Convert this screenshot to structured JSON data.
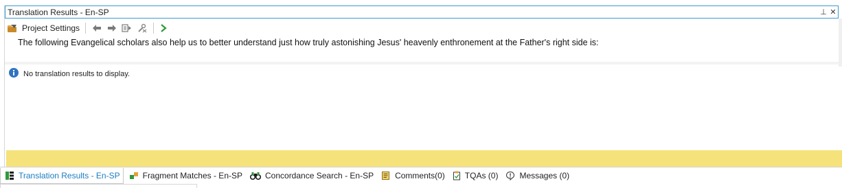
{
  "window": {
    "title": "Translation Results - En-SP",
    "pin_glyph": "⊥",
    "close_glyph": "✕"
  },
  "toolbar": {
    "project_settings_label": "Project Settings",
    "icons": [
      "project-settings-icon",
      "arrow-left-icon",
      "arrow-right-icon",
      "apply-icon",
      "tools-icon",
      "play-icon"
    ]
  },
  "source_segment": "The following Evangelical scholars also help us to better understand just how truly astonishing Jesus' heavenly enthronement at the Father's right side is:",
  "results": {
    "empty_message": "No translation results to display."
  },
  "tabs": [
    {
      "label": "Translation Results - En-SP",
      "icon": "translation-results-icon",
      "active": true
    },
    {
      "label": "Fragment Matches - En-SP",
      "icon": "fragment-matches-icon",
      "active": false
    },
    {
      "label": "Concordance Search - En-SP",
      "icon": "binoculars-icon",
      "active": false
    },
    {
      "label": "Comments(0)",
      "icon": "comments-icon",
      "active": false
    },
    {
      "label": "TQAs (0)",
      "icon": "tqa-icon",
      "active": false
    },
    {
      "label": "Messages (0)",
      "icon": "messages-icon",
      "active": false
    }
  ],
  "colors": {
    "accent": "#3a9ccf",
    "active_tab_text": "#1b7dc0",
    "info": "#2f74c0",
    "highlight": "#f6e27a",
    "play": "#2e9a3a"
  }
}
